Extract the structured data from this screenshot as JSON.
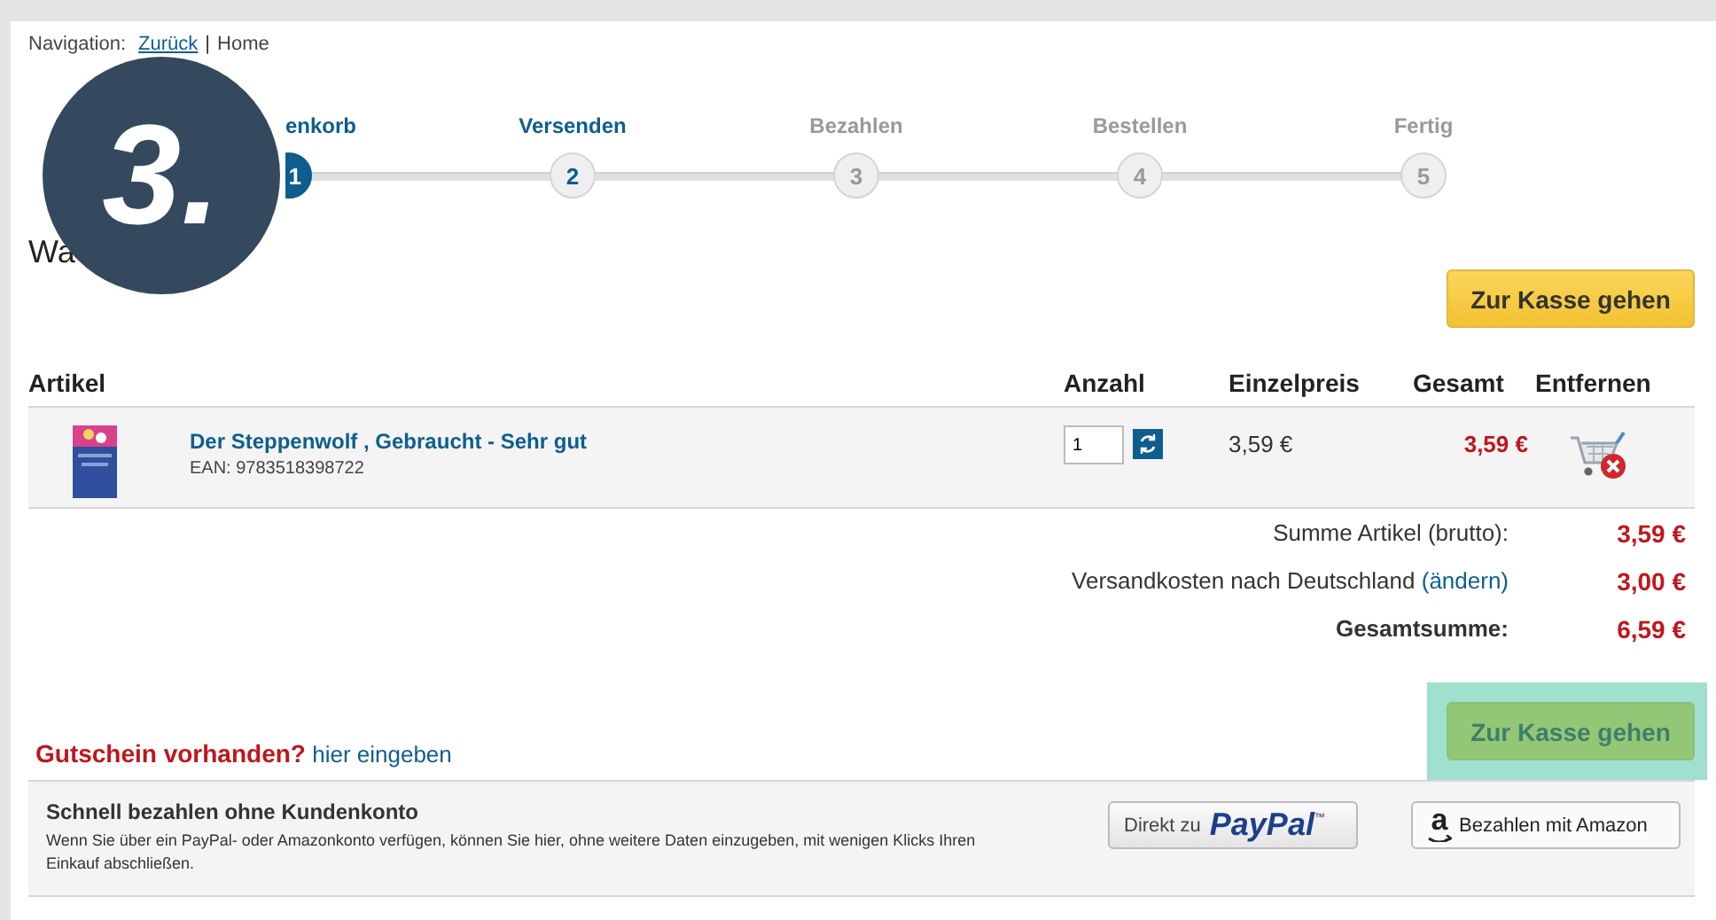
{
  "navigation": {
    "label": "Navigation:",
    "links": [
      {
        "text": "Zurück",
        "kind": "link"
      },
      {
        "text": "Home",
        "kind": "plain"
      }
    ],
    "separator": "|"
  },
  "annotation_badge": "3.",
  "steps": [
    {
      "label": "enkorb",
      "number": "1",
      "selected": true,
      "enabled": true
    },
    {
      "label": "Versenden",
      "number": "2",
      "selected": false,
      "enabled": true
    },
    {
      "label": "Bezahlen",
      "number": "3",
      "selected": false,
      "enabled": false
    },
    {
      "label": "Bestellen",
      "number": "4",
      "selected": false,
      "enabled": false
    },
    {
      "label": "Fertig",
      "number": "5",
      "selected": false,
      "enabled": false
    }
  ],
  "heading": "Wa",
  "checkout_top": {
    "label": "Zur Kasse gehen"
  },
  "table": {
    "columns": [
      "Artikel",
      "Anzahl",
      "Einzelpreis",
      "Gesamt",
      "Entfernen"
    ],
    "rows": [
      {
        "title": "Der Steppenwolf , Gebraucht - Sehr gut",
        "ean": "EAN: 9783518398722",
        "quantity": "1",
        "unit_price": "3,59 €",
        "total": "3,59 €"
      }
    ]
  },
  "summary": [
    {
      "label": "Summe Artikel (brutto):",
      "value": "3,59 €",
      "bold": false
    },
    {
      "label": "Versandkosten nach Deutschland",
      "link": "(ändern)",
      "value": "3,00 €",
      "bold": false
    },
    {
      "label": "Gesamtsumme:",
      "value": "6,59 €",
      "bold": true
    }
  ],
  "coupon": {
    "question": "Gutschein vorhanden?",
    "link": "hier eingeben"
  },
  "checkout_bottom": {
    "label": "Zur Kasse gehen",
    "highlighted": true
  },
  "express": {
    "title": "Schnell bezahlen ohne Kundenkonto",
    "text": "Wenn Sie über ein PayPal- oder Amazonkonto verfügen, können Sie hier, ohne weitere Daten einzugeben, mit wenigen Klicks Ihren Einkauf abschließen.",
    "paypal": {
      "prefix": "Direkt zu",
      "brand": "PayPal",
      "mark": "™"
    },
    "amazon": {
      "letter": "a",
      "label": "Bezahlen mit Amazon"
    }
  }
}
